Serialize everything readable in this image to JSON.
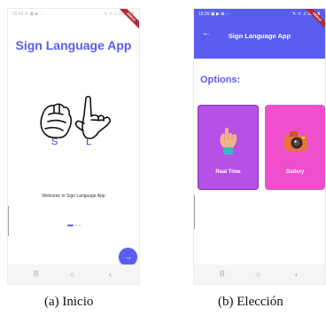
{
  "screen_a": {
    "status_time": "15:42",
    "status_icons_left": "✉ ▣ ▶ ···",
    "status_icons_right": "✎ ᯤ .ıl 100% ▮",
    "debug_label": "DEBUG",
    "app_title": "Sign Language App",
    "letter_1": "S",
    "letter_2": "L",
    "welcome_text": "Welcome to Sign Language App",
    "fab_icon": "arrow-right-icon",
    "fab_glyph": "→"
  },
  "screen_b": {
    "status_time": "15:26",
    "status_icons_left": "▣ ▶ ✿ ···",
    "status_icons_right": "✎ ᯤ .ıl 32% ▮",
    "debug_label": "DEBUG",
    "back_glyph": "←",
    "app_bar_title": "Sign Language App",
    "options_label": "Options:",
    "cards": [
      {
        "label": "Real Time",
        "icon": "hand-icon",
        "color": "#b750e6"
      },
      {
        "label": "Gallery",
        "icon": "camera-icon",
        "color": "#ef4ecd"
      }
    ]
  },
  "nav_bar": {
    "recent_glyph": "|||",
    "home_glyph": "○",
    "back_glyph": "‹"
  },
  "captions": {
    "a": "(a) Inicio",
    "b": "(b) Elección"
  },
  "colors": {
    "primary": "#5a5df0",
    "card_realtime": "#b750e6",
    "card_gallery": "#ef4ecd"
  }
}
